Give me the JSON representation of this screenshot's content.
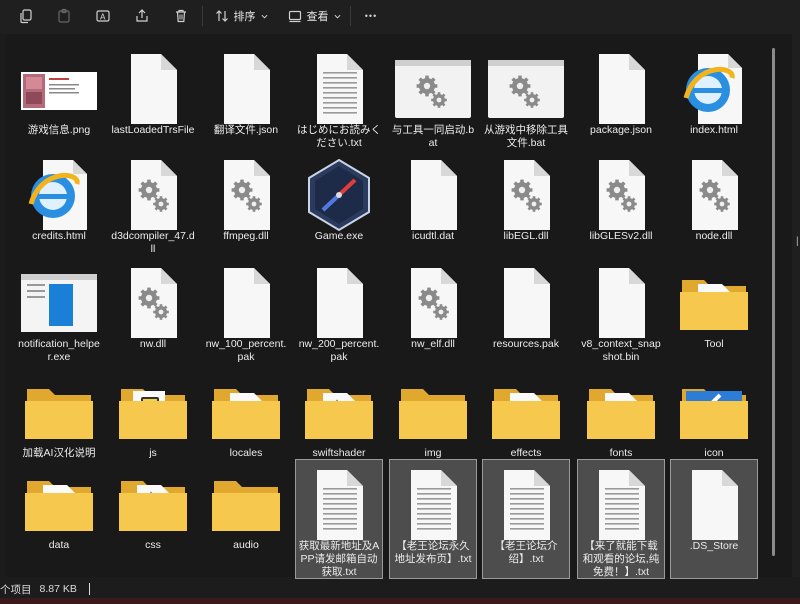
{
  "toolbar": {
    "sort_label": "排序",
    "view_label": "查看",
    "more_label": "•••"
  },
  "status": {
    "count": "个项目",
    "size": "8.87 KB"
  },
  "items": [
    {
      "name": "游戏信息.png",
      "type": "image"
    },
    {
      "name": "lastLoadedTrsFile",
      "type": "file"
    },
    {
      "name": "翻译文件.json",
      "type": "file"
    },
    {
      "name": "はじめにお読みください.txt",
      "type": "text"
    },
    {
      "name": "与工具一同启动.bat",
      "type": "bat"
    },
    {
      "name": "从游戏中移除工具文件.bat",
      "type": "bat"
    },
    {
      "name": "package.json",
      "type": "file"
    },
    {
      "name": "index.html",
      "type": "html"
    },
    {
      "name": "credits.html",
      "type": "html"
    },
    {
      "name": "d3dcompiler_47.dll",
      "type": "dll"
    },
    {
      "name": "ffmpeg.dll",
      "type": "dll"
    },
    {
      "name": "Game.exe",
      "type": "exe-game"
    },
    {
      "name": "icudtl.dat",
      "type": "file"
    },
    {
      "name": "libEGL.dll",
      "type": "dll"
    },
    {
      "name": "libGLESv2.dll",
      "type": "dll"
    },
    {
      "name": "node.dll",
      "type": "dll"
    },
    {
      "name": "notification_helper.exe",
      "type": "exe-notify"
    },
    {
      "name": "nw.dll",
      "type": "dll"
    },
    {
      "name": "nw_100_percent.pak",
      "type": "file"
    },
    {
      "name": "nw_200_percent.pak",
      "type": "file"
    },
    {
      "name": "nw_elf.dll",
      "type": "dll"
    },
    {
      "name": "resources.pak",
      "type": "file"
    },
    {
      "name": "v8_context_snapshot.bin",
      "type": "file"
    },
    {
      "name": "Tool",
      "type": "folder-doc"
    },
    {
      "name": "加载AI汉化说明",
      "type": "folder"
    },
    {
      "name": "js",
      "type": "folder-js"
    },
    {
      "name": "locales",
      "type": "folder-doc"
    },
    {
      "name": "swiftshader",
      "type": "folder-gear"
    },
    {
      "name": "img",
      "type": "folder"
    },
    {
      "name": "effects",
      "type": "folder-doc"
    },
    {
      "name": "fonts",
      "type": "folder-doc"
    },
    {
      "name": "icon",
      "type": "folder-icon"
    },
    {
      "name": "data",
      "type": "folder-doc"
    },
    {
      "name": "css",
      "type": "folder-gear"
    },
    {
      "name": "audio",
      "type": "folder"
    },
    {
      "name": "获取最新地址及APP请发邮箱自动获取.txt",
      "type": "text"
    },
    {
      "name": "【老王论坛永久地址发布页】.txt",
      "type": "text"
    },
    {
      "name": "【老王论坛介绍】.txt",
      "type": "text"
    },
    {
      "name": "【来了就能下载和观看的论坛,纯免费！】.txt",
      "type": "text"
    },
    {
      "name": ".DS_Store",
      "type": "file"
    }
  ],
  "selected": [
    35,
    36,
    37,
    38,
    39
  ]
}
